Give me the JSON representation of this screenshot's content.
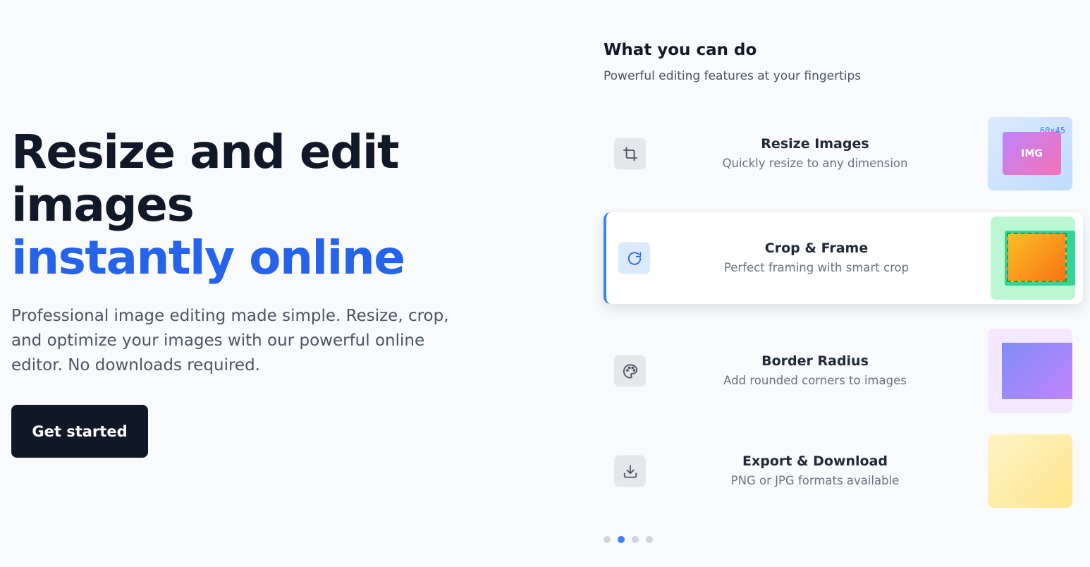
{
  "hero": {
    "title_line1": "Resize and edit",
    "title_line2": "images",
    "title_accent": "instantly online",
    "description": "Professional image editing made simple. Resize, crop, and optimize your images with our powerful online editor. No downloads required.",
    "cta_label": "Get started"
  },
  "features": {
    "heading": "What you can do",
    "subheading": "Powerful editing features at your fingertips",
    "items": [
      {
        "title": "Resize Images",
        "description": "Quickly resize to any dimension",
        "icon": "crop-icon",
        "preview_dim": "60×45",
        "preview_label": "IMG"
      },
      {
        "title": "Crop & Frame",
        "description": "Perfect framing with smart crop",
        "icon": "rotate-icon"
      },
      {
        "title": "Border Radius",
        "description": "Add rounded corners to images",
        "icon": "palette-icon"
      },
      {
        "title": "Export & Download",
        "description": "PNG or JPG formats available",
        "icon": "download-icon"
      }
    ],
    "active_index": 1
  },
  "pagination": {
    "count": 4,
    "active": 1
  },
  "colors": {
    "accent": "#2563eb",
    "primary_dark": "#111827",
    "active_border": "#3b82f6"
  }
}
